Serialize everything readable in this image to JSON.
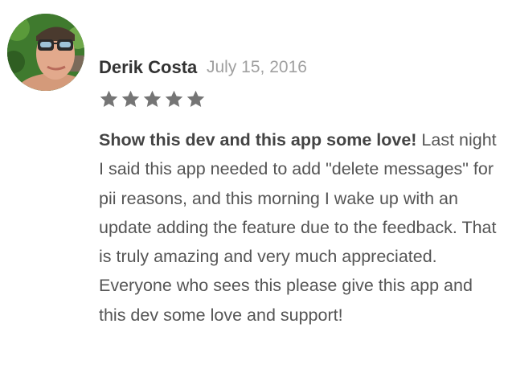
{
  "review": {
    "author": "Derik Costa",
    "date": "July 15, 2016",
    "rating": 5,
    "rating_max": 5,
    "headline": "Show this dev and this app some love!",
    "text": "Last night I said this app needed to add \"delete messages\" for pii reasons, and this morning I wake up with an update adding the feature due to the feedback. That is truly amazing and very much appreciated. Everyone who sees this please give this app and this dev some love and support!"
  },
  "colors": {
    "author": "#333333",
    "date": "#a0a0a0",
    "star": "#757575",
    "body": "#555555"
  },
  "icons": {
    "star": "star-icon",
    "avatar": "avatar"
  }
}
